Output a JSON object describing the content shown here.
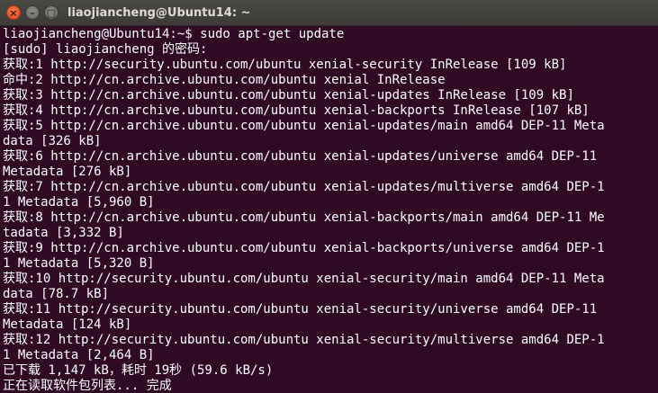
{
  "window": {
    "title": "liaojiancheng@Ubuntu14: ~",
    "close_glyph": "×",
    "minimize_glyph": "–",
    "maximize_glyph": "□"
  },
  "terminal": {
    "lines": [
      "liaojiancheng@Ubuntu14:~$ sudo apt-get update",
      "[sudo] liaojiancheng 的密码:",
      "获取:1 http://security.ubuntu.com/ubuntu xenial-security InRelease [109 kB]",
      "命中:2 http://cn.archive.ubuntu.com/ubuntu xenial InRelease",
      "获取:3 http://cn.archive.ubuntu.com/ubuntu xenial-updates InRelease [109 kB]",
      "获取:4 http://cn.archive.ubuntu.com/ubuntu xenial-backports InRelease [107 kB]",
      "获取:5 http://cn.archive.ubuntu.com/ubuntu xenial-updates/main amd64 DEP-11 Meta",
      "data [326 kB]",
      "获取:6 http://cn.archive.ubuntu.com/ubuntu xenial-updates/universe amd64 DEP-11",
      "Metadata [276 kB]",
      "获取:7 http://cn.archive.ubuntu.com/ubuntu xenial-updates/multiverse amd64 DEP-1",
      "1 Metadata [5,960 B]",
      "获取:8 http://cn.archive.ubuntu.com/ubuntu xenial-backports/main amd64 DEP-11 Me",
      "tadata [3,332 B]",
      "获取:9 http://cn.archive.ubuntu.com/ubuntu xenial-backports/universe amd64 DEP-1",
      "1 Metadata [5,320 B]",
      "获取:10 http://security.ubuntu.com/ubuntu xenial-security/main amd64 DEP-11 Meta",
      "data [78.7 kB]",
      "获取:11 http://security.ubuntu.com/ubuntu xenial-security/universe amd64 DEP-11",
      "Metadata [124 kB]",
      "获取:12 http://security.ubuntu.com/ubuntu xenial-security/multiverse amd64 DEP-1",
      "1 Metadata [2,464 B]",
      "已下载 1,147 kB，耗时 19秒 (59.6 kB/s)",
      "正在读取软件包列表... 完成"
    ]
  }
}
